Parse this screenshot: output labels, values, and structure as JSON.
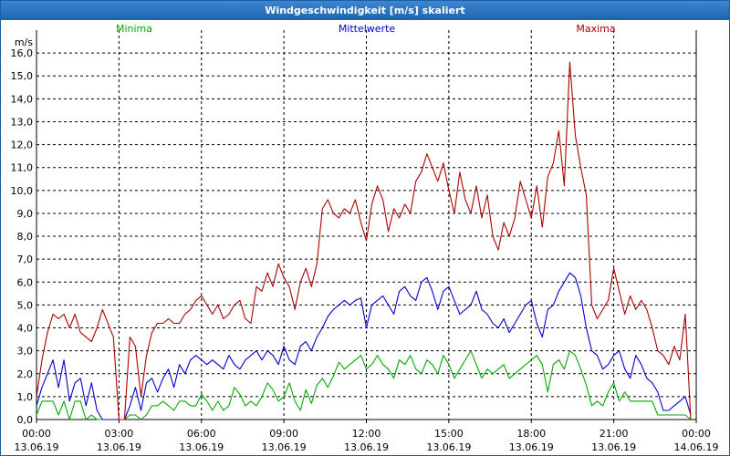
{
  "window": {
    "title": "Windgeschwindigkeit [m/s] skaliert"
  },
  "chart_data": {
    "type": "line",
    "title": "Windgeschwindigkeit [m/s] skaliert",
    "ylabel": "m/s",
    "ylim": [
      0,
      17
    ],
    "grid": true,
    "legend_placement": "top",
    "y_ticks": [
      "0,0",
      "1,0",
      "2,0",
      "3,0",
      "4,0",
      "5,0",
      "6,0",
      "7,0",
      "8,0",
      "9,0",
      "10,0",
      "11,0",
      "12,0",
      "13,0",
      "14,0",
      "15,0",
      "16,0"
    ],
    "x_ticks": [
      {
        "time": "00:00",
        "date": "13.06.19"
      },
      {
        "time": "03:00",
        "date": "13.06.19"
      },
      {
        "time": "06:00",
        "date": "13.06.19"
      },
      {
        "time": "09:00",
        "date": "13.06.19"
      },
      {
        "time": "12:00",
        "date": "13.06.19"
      },
      {
        "time": "15:00",
        "date": "13.06.19"
      },
      {
        "time": "18:00",
        "date": "13.06.19"
      },
      {
        "time": "21:00",
        "date": "13.06.19"
      },
      {
        "time": "00:00",
        "date": "14.06.19"
      }
    ],
    "x_hours": [
      0,
      0.2,
      0.4,
      0.6,
      0.8,
      1,
      1.2,
      1.4,
      1.6,
      1.8,
      2,
      2.2,
      2.4,
      2.6,
      2.8,
      3,
      3.2,
      3.4,
      3.6,
      3.8,
      4,
      4.2,
      4.4,
      4.6,
      4.8,
      5,
      5.2,
      5.4,
      5.6,
      5.8,
      6,
      6.2,
      6.4,
      6.6,
      6.8,
      7,
      7.2,
      7.4,
      7.6,
      7.8,
      8,
      8.2,
      8.4,
      8.6,
      8.8,
      9,
      9.2,
      9.4,
      9.6,
      9.8,
      10,
      10.2,
      10.4,
      10.6,
      10.8,
      11,
      11.2,
      11.4,
      11.6,
      11.8,
      12,
      12.2,
      12.4,
      12.6,
      12.8,
      13,
      13.2,
      13.4,
      13.6,
      13.8,
      14,
      14.2,
      14.4,
      14.6,
      14.8,
      15,
      15.2,
      15.4,
      15.6,
      15.8,
      16,
      16.2,
      16.4,
      16.6,
      16.8,
      17,
      17.2,
      17.4,
      17.6,
      17.8,
      18,
      18.2,
      18.4,
      18.6,
      18.8,
      19,
      19.2,
      19.4,
      19.6,
      19.8,
      20,
      20.2,
      20.4,
      20.6,
      20.8,
      21,
      21.2,
      21.4,
      21.6,
      21.8,
      22,
      22.2,
      22.4,
      22.6,
      22.8,
      23,
      23.2,
      23.4,
      23.6,
      23.8
    ],
    "series": [
      {
        "name": "Minima",
        "color": "#00aa00",
        "values": [
          0.2,
          0.8,
          0.8,
          0.8,
          0.2,
          0.8,
          0.0,
          0.8,
          0.8,
          0.0,
          0.2,
          0.0,
          0.0,
          0.0,
          0.0,
          0.0,
          0.0,
          0.2,
          0.2,
          0.0,
          0.2,
          0.6,
          0.6,
          0.8,
          0.6,
          0.4,
          0.8,
          0.8,
          0.6,
          0.6,
          1.1,
          0.8,
          0.4,
          0.8,
          0.4,
          0.6,
          1.4,
          1.1,
          0.6,
          0.8,
          0.6,
          1.0,
          1.6,
          1.3,
          0.8,
          1.0,
          1.6,
          0.8,
          0.4,
          1.3,
          0.7,
          1.5,
          1.8,
          1.4,
          1.9,
          2.5,
          2.2,
          2.4,
          2.6,
          2.8,
          2.2,
          2.4,
          2.8,
          2.4,
          2.2,
          1.8,
          2.6,
          2.4,
          2.8,
          2.2,
          2.0,
          2.6,
          2.4,
          2.0,
          2.8,
          2.4,
          1.8,
          2.2,
          2.6,
          3.0,
          2.4,
          1.8,
          2.2,
          2.0,
          2.2,
          2.4,
          1.8,
          2.0,
          2.2,
          2.4,
          2.6,
          2.8,
          2.4,
          1.2,
          2.4,
          2.6,
          2.2,
          3.0,
          2.8,
          2.2,
          1.5,
          0.6,
          0.8,
          0.6,
          1.2,
          1.6,
          0.8,
          1.2,
          0.8,
          0.8,
          0.8,
          0.8,
          0.8,
          0.2,
          0.2,
          0.2,
          0.2,
          0.2,
          0.2,
          0.0
        ]
      },
      {
        "name": "Mittelwerte",
        "color": "#0000cc",
        "values": [
          0.6,
          1.4,
          2.0,
          2.6,
          1.4,
          2.6,
          0.8,
          1.6,
          1.8,
          0.6,
          1.6,
          0.4,
          0.0,
          0.0,
          0.0,
          0.0,
          0.0,
          0.6,
          1.4,
          0.4,
          1.6,
          1.8,
          1.2,
          1.8,
          2.2,
          1.4,
          2.4,
          2.0,
          2.6,
          2.8,
          2.6,
          2.4,
          2.6,
          2.4,
          2.2,
          2.8,
          2.4,
          2.2,
          2.6,
          2.8,
          3.0,
          2.6,
          3.0,
          2.8,
          2.4,
          3.2,
          2.6,
          2.4,
          3.2,
          3.4,
          3.0,
          3.6,
          4.0,
          4.5,
          4.8,
          5.0,
          5.2,
          5.0,
          5.2,
          5.3,
          4.0,
          5.0,
          5.2,
          5.4,
          5.0,
          4.6,
          5.6,
          5.8,
          5.4,
          5.2,
          6.0,
          6.2,
          5.6,
          4.8,
          5.6,
          5.8,
          5.2,
          4.6,
          4.8,
          5.0,
          5.6,
          4.8,
          4.6,
          4.2,
          4.0,
          4.4,
          3.8,
          4.2,
          4.6,
          5.0,
          5.2,
          4.2,
          3.6,
          4.8,
          5.0,
          5.6,
          6.0,
          6.4,
          6.2,
          5.4,
          4.0,
          3.0,
          2.8,
          2.2,
          2.4,
          2.8,
          3.0,
          2.2,
          1.8,
          2.8,
          2.4,
          1.8,
          1.6,
          1.2,
          0.4,
          0.4,
          0.6,
          0.8,
          1.0,
          0.2
        ]
      },
      {
        "name": "Maxima",
        "color": "#aa0000",
        "values": [
          1.0,
          2.6,
          3.8,
          4.6,
          4.4,
          4.6,
          4.0,
          4.6,
          3.8,
          3.6,
          3.4,
          4.0,
          4.8,
          4.2,
          3.6,
          0.0,
          0.0,
          3.6,
          3.2,
          1.0,
          2.8,
          3.8,
          4.2,
          4.2,
          4.4,
          4.2,
          4.2,
          4.6,
          4.8,
          5.2,
          5.4,
          5.0,
          4.6,
          5.0,
          4.4,
          4.6,
          5.0,
          5.2,
          4.4,
          4.2,
          5.8,
          5.6,
          6.4,
          5.8,
          6.8,
          6.2,
          5.8,
          4.8,
          6.0,
          6.6,
          5.8,
          6.8,
          9.2,
          9.6,
          9.0,
          8.8,
          9.2,
          9.0,
          9.6,
          8.6,
          7.8,
          9.4,
          10.2,
          9.6,
          8.2,
          9.2,
          8.8,
          9.4,
          9.0,
          10.4,
          10.8,
          11.6,
          11.0,
          10.4,
          11.2,
          10.0,
          9.0,
          10.8,
          9.6,
          9.0,
          10.2,
          8.8,
          9.8,
          8.0,
          7.4,
          8.6,
          8.0,
          8.8,
          10.4,
          9.6,
          8.8,
          10.2,
          8.4,
          10.6,
          11.2,
          12.6,
          10.2,
          15.6,
          12.4,
          11.0,
          9.8,
          5.0,
          4.4,
          4.8,
          5.2,
          6.6,
          5.6,
          4.6,
          5.4,
          4.8,
          5.2,
          4.8,
          4.0,
          3.0,
          2.8,
          2.4,
          3.2,
          2.6,
          4.6,
          0.0
        ]
      }
    ]
  }
}
